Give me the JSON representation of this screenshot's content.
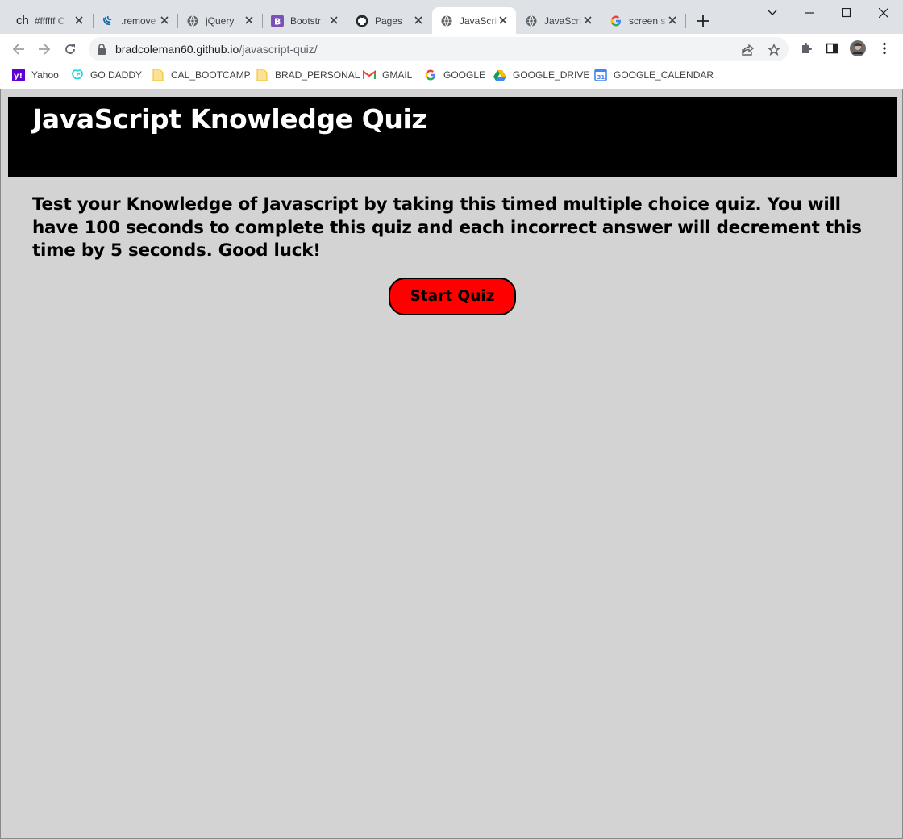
{
  "browser": {
    "tabs": [
      {
        "label": "#ffffff C",
        "icon": "ch-favicon-icon",
        "prefix": "ch"
      },
      {
        "label": ".remove",
        "icon": "jquery-favicon-icon"
      },
      {
        "label": "jQuery",
        "icon": "globe-icon"
      },
      {
        "label": "Bootstr",
        "icon": "bootstrap-favicon-icon"
      },
      {
        "label": "Pages",
        "icon": "github-icon"
      },
      {
        "label": "JavaScri",
        "icon": "globe-icon",
        "active": true
      },
      {
        "label": "JavaScri",
        "icon": "globe-icon"
      },
      {
        "label": "screen s",
        "icon": "google-icon"
      }
    ],
    "url_host": "bradcoleman60.github.io",
    "url_path": "/javascript-quiz/",
    "bookmarks": [
      {
        "label": "Yahoo",
        "icon": "yahoo-icon"
      },
      {
        "label": "GO DADDY",
        "icon": "godaddy-icon"
      },
      {
        "label": "CAL_BOOTCAMP",
        "icon": "folder-icon"
      },
      {
        "label": "BRAD_PERSONAL",
        "icon": "folder-icon"
      },
      {
        "label": "GMAIL",
        "icon": "gmail-icon"
      },
      {
        "label": "GOOGLE",
        "icon": "google-icon"
      },
      {
        "label": "GOOGLE_DRIVE",
        "icon": "google-drive-icon"
      },
      {
        "label": "GOOGLE_CALENDAR",
        "icon": "google-calendar-icon"
      }
    ]
  },
  "page": {
    "title": "JavaScript Knowledge Quiz",
    "intro": "Test your Knowledge of Javascript by taking this timed multiple choice quiz. You will have 100 seconds to complete this quiz and each incorrect answer will decrement this time by 5 seconds. Good luck!",
    "start_button": "Start Quiz",
    "colors": {
      "background": "#d3d3d3",
      "header": "#000000",
      "header_text": "#ffffff",
      "button": "#ff0000"
    }
  }
}
